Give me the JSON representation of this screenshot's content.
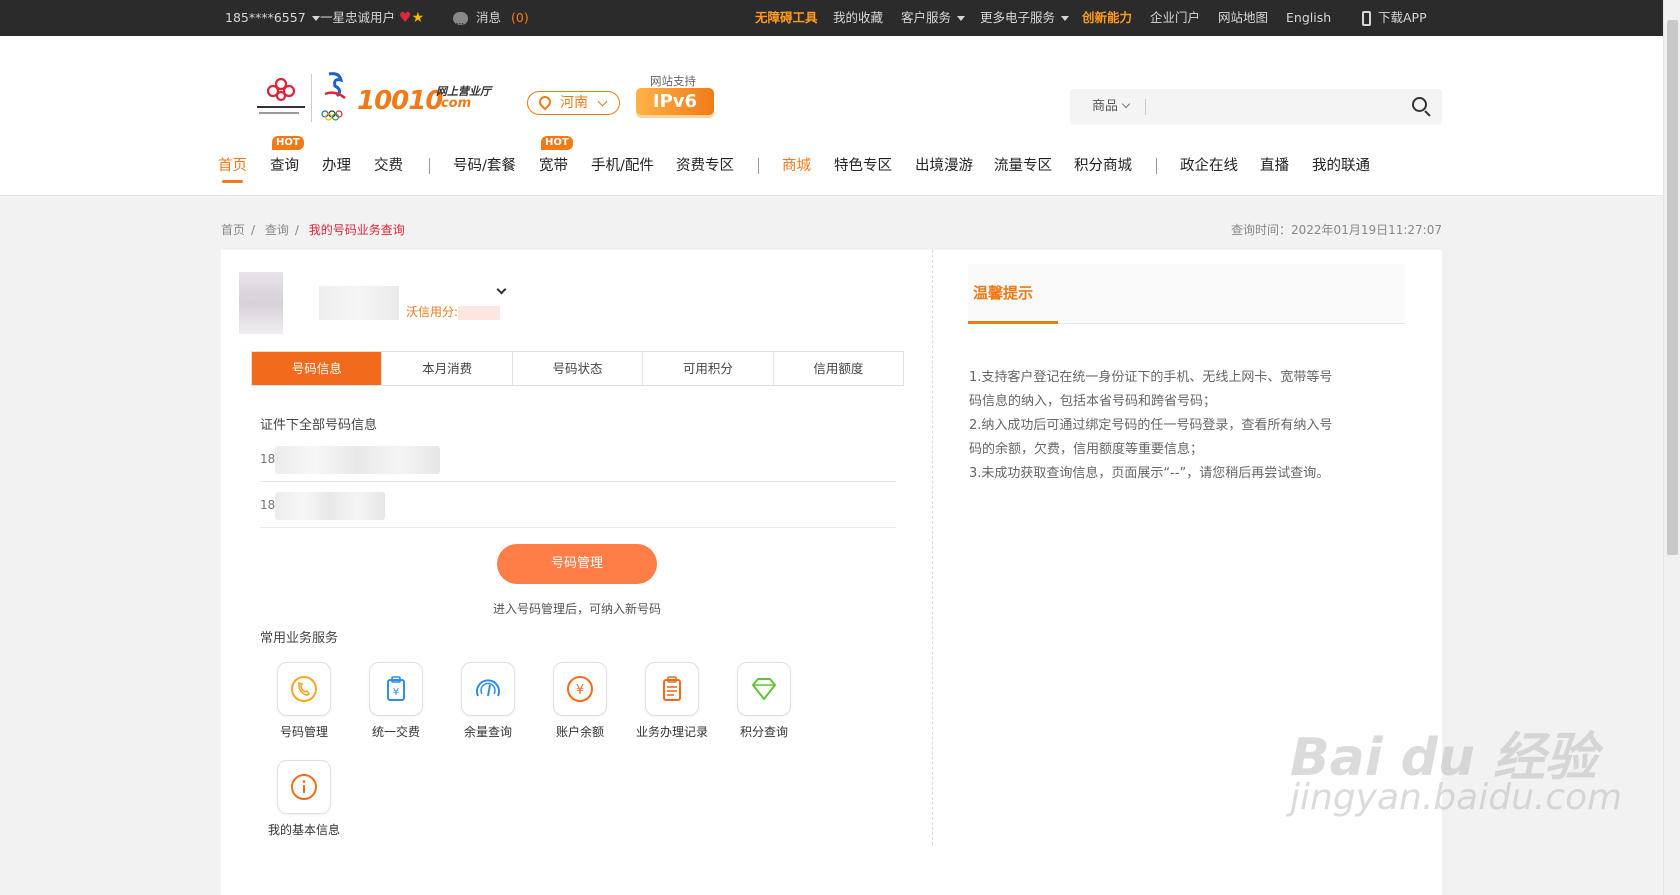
{
  "topbar": {
    "phone": "185****6557",
    "loyalty": "一星忠诚用户",
    "messages_label": "消息",
    "messages_count": "(0)",
    "links": [
      {
        "label": "无障碍工具",
        "highlight": true
      },
      {
        "label": "我的收藏"
      },
      {
        "label": "客户服务",
        "dropdown": true
      },
      {
        "label": "更多电子服务",
        "dropdown": true
      },
      {
        "label": "创新能力",
        "highlight": true
      },
      {
        "label": "企业门户"
      },
      {
        "label": "网站地图"
      },
      {
        "label": "English"
      }
    ],
    "download_app": "下载APP"
  },
  "header": {
    "brand": "10010",
    "brand_sub_1": "网上营业厅",
    "brand_sub_2": ".com",
    "region": "河南",
    "ipv6_label": "网站支持",
    "ipv6_badge": "IPv6",
    "search_category": "商品",
    "search_placeholder": ""
  },
  "nav": [
    {
      "label": "首页",
      "active": true
    },
    {
      "label": "查询",
      "hot": "HOT"
    },
    {
      "label": "办理"
    },
    {
      "label": "交费"
    },
    {
      "label": "号码/套餐"
    },
    {
      "label": "宽带",
      "hot": "HOT"
    },
    {
      "label": "手机/配件"
    },
    {
      "label": "资费专区"
    },
    {
      "label": "商城",
      "orange": true
    },
    {
      "label": "特色专区"
    },
    {
      "label": "出境漫游"
    },
    {
      "label": "流量专区"
    },
    {
      "label": "积分商城"
    },
    {
      "label": "政企在线"
    },
    {
      "label": "直播"
    },
    {
      "label": "我的联通"
    }
  ],
  "breadcrumb": [
    "首页",
    "查询",
    "我的号码业务查询"
  ],
  "query_time": "查询时间：2022年01月19日11:27:07",
  "account": {
    "wo_points_label": "沃信用分:"
  },
  "tabs": [
    "号码信息",
    "本月消费",
    "号码状态",
    "可用积分",
    "信用额度"
  ],
  "numbers_section_title": "证件下全部号码信息",
  "numbers": [
    {
      "prefix": "18"
    },
    {
      "prefix": "18"
    }
  ],
  "manage_button": "号码管理",
  "manage_tip": "进入号码管理后，可纳入新号码",
  "services_title": "常用业务服务",
  "services": [
    {
      "label": "号码管理",
      "icon": "phone-icon",
      "color": "#f5a623"
    },
    {
      "label": "统一交费",
      "icon": "clipboard-yen-icon",
      "color": "#2f8ee8"
    },
    {
      "label": "余量查询",
      "icon": "gauge-icon",
      "color": "#2f8ee8"
    },
    {
      "label": "账户余额",
      "icon": "yen-coin-icon",
      "color": "#f26b1d"
    },
    {
      "label": "业务办理记录",
      "icon": "record-icon",
      "color": "#f26b1d"
    },
    {
      "label": "积分查询",
      "icon": "diamond-icon",
      "color": "#62c23a"
    },
    {
      "label": "我的基本信息",
      "icon": "info-icon",
      "color": "#f26b1d"
    }
  ],
  "tips": {
    "title": "温馨提示",
    "lines": [
      "1.支持客户登记在统一身份证下的手机、无线上网卡、宽带等号码信息的纳入，包括本省号码和跨省号码；",
      "2.纳入成功后可通过绑定号码的任一号码登录，查看所有纳入号码的余额，欠费，信用额度等重要信息；",
      "3.未成功获取查询信息，页面展示“--”，请您稍后再尝试查询。"
    ]
  },
  "watermark": {
    "main": "Bai du 经验",
    "sub": "jingyan.baidu.com"
  }
}
